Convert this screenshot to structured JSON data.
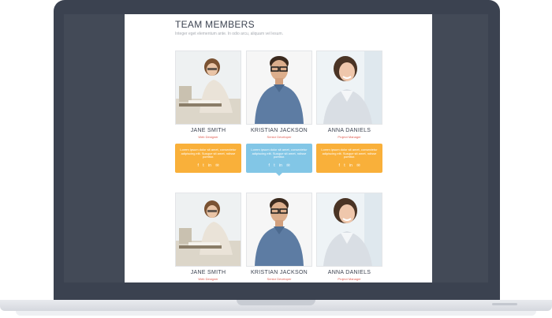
{
  "section": {
    "title": "TEAM MEMBERS",
    "subtitle": "Integer eget elementum ante. In odio arcu, aliquam vel lesum."
  },
  "row1": [
    {
      "name": "JANE SMITH",
      "role": "Web Designer",
      "photo_icon": "woman-at-desk-photo"
    },
    {
      "name": "KRISTIAN JACKSON",
      "role": "Senior Developer",
      "photo_icon": "man-glasses-photo"
    },
    {
      "name": "ANNA DANIELS",
      "role": "Project Manager",
      "photo_icon": "woman-smiling-photo"
    }
  ],
  "bubbles": [
    {
      "text": "Lorem ipsum dolor sit amet, consectetur adipiscing elit. Susque sit amet, ndisse porttitor.",
      "color": "#f9b03a"
    },
    {
      "text": "Lorem ipsum dolor sit amet, consectetur adipiscing elit. Susque sit amet, ndisse porttitor.",
      "color": "#82c6e6"
    },
    {
      "text": "Lorem ipsum dolor sit amet, consectetur adipiscing elit. Susque sit amet, ndisse porttitor.",
      "color": "#f9b03a"
    }
  ],
  "social": [
    "f",
    "t",
    "in",
    "✉"
  ],
  "row2": [
    {
      "name": "JANE SMITH",
      "role": "Web Designer"
    },
    {
      "name": "KRISTIAN JACKSON",
      "role": "Senior Developer"
    },
    {
      "name": "ANNA DANIELS",
      "role": "Project Manager"
    }
  ]
}
